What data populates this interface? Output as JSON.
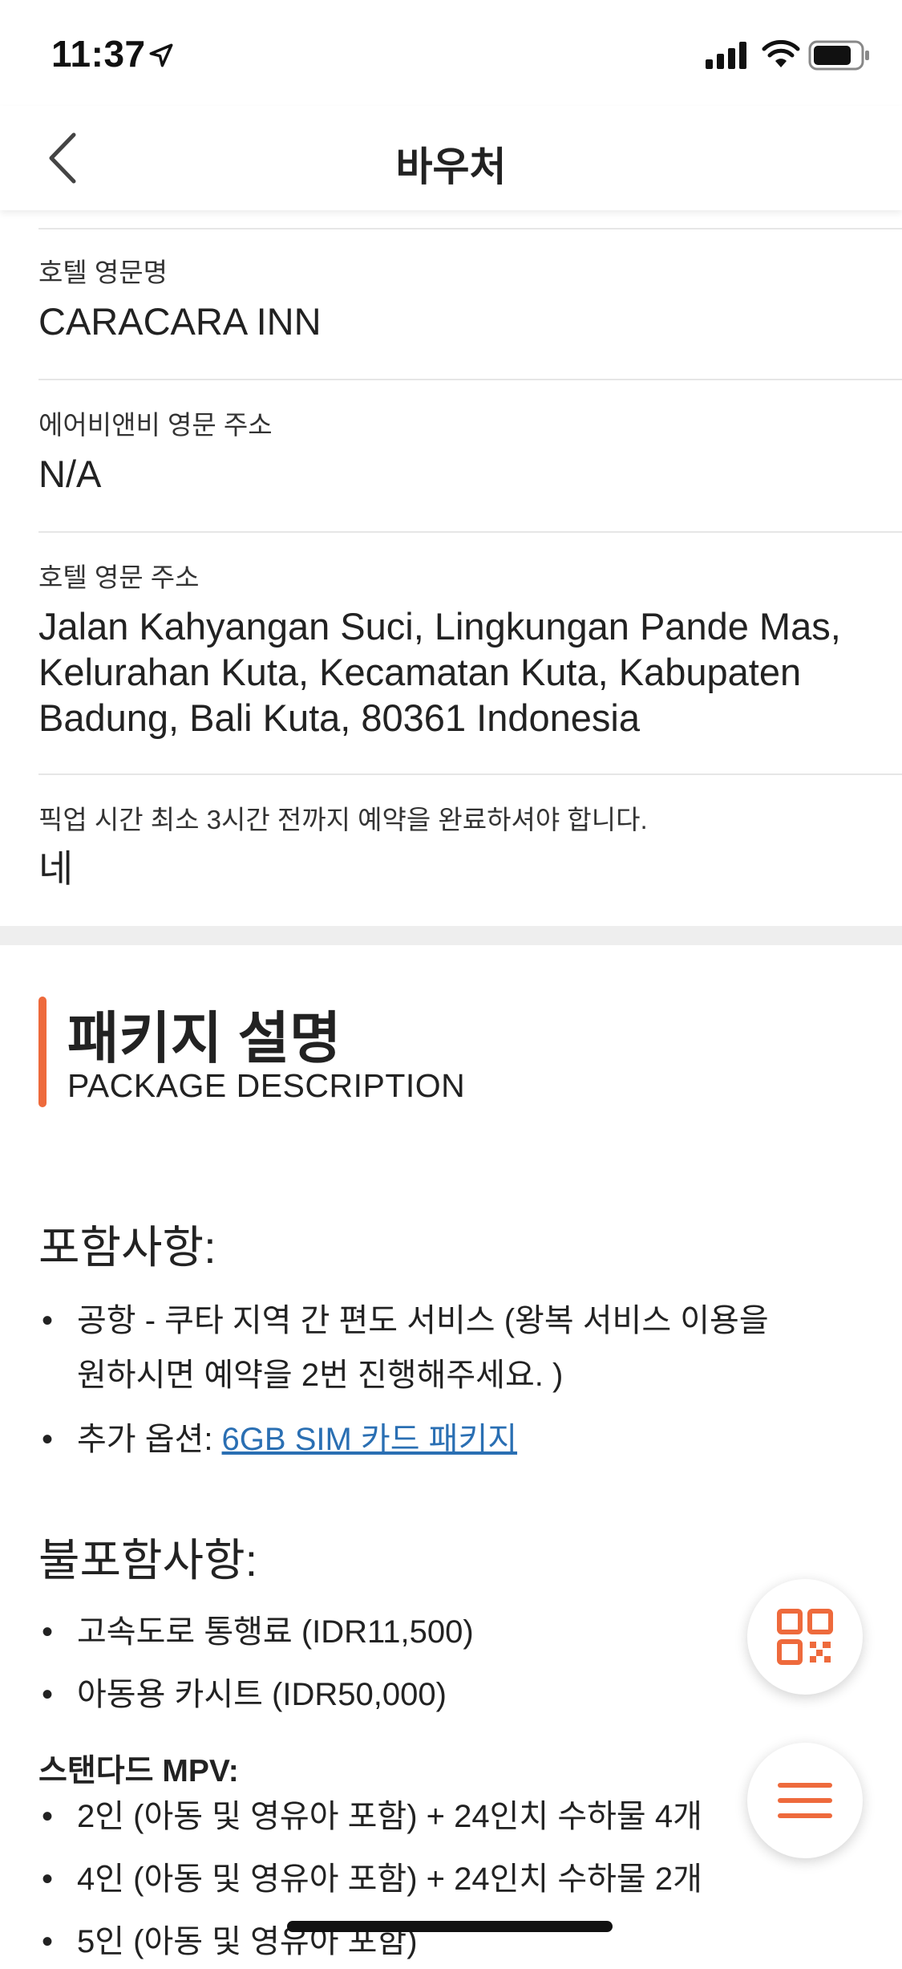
{
  "status_bar": {
    "time": "11:37"
  },
  "nav": {
    "title": "바우처"
  },
  "fields": [
    {
      "label": "호텔 영문명",
      "value": "CARACARA INN"
    },
    {
      "label": "에어비앤비 영문 주소",
      "value": "N/A"
    },
    {
      "label": "호텔 영문 주소",
      "value": "Jalan Kahyangan Suci, Lingkungan Pande Mas, Kelurahan Kuta, Kecamatan Kuta, Kabupaten Badung, Bali Kuta, 80361 Indonesia"
    },
    {
      "label": "픽업 시간 최소 3시간 전까지 예약을 완료하셔야 합니다.",
      "value": "네"
    }
  ],
  "package": {
    "title": "패키지 설명",
    "subtitle": "PACKAGE DESCRIPTION",
    "included_heading": "포함사항:",
    "included": [
      "공항 - 쿠타 지역 간 편도 서비스 (왕복 서비스 이용을 원하시면 예약을 2번 진행해주세요. )",
      {
        "prefix": "추가 옵션: ",
        "link": "6GB SIM 카드 패키지"
      }
    ],
    "excluded_heading": "불포함사항:",
    "excluded": [
      "고속도로 통행료 (IDR11,500)",
      "아동용 카시트 (IDR50,000)"
    ],
    "mpv_heading": "스탠다드 MPV:",
    "mpv": [
      "2인 (아동 및 영유아 포함) + 24인치 수하물 4개",
      "4인 (아동 및 영유아 포함) + 24인치 수하물 2개",
      "5인 (아동 및 영유아 포함)"
    ]
  },
  "fabs": {
    "qr_icon": "qr-code-icon",
    "menu_icon": "menu-icon"
  },
  "colors": {
    "accent": "#ee6a3c",
    "link": "#2a6fb3",
    "divider": "#e6e6e6"
  }
}
